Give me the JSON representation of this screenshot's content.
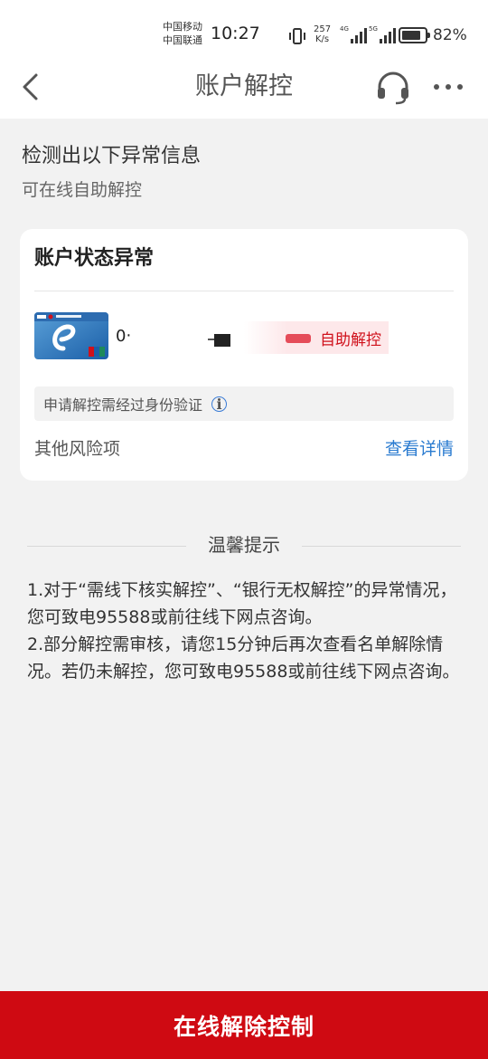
{
  "status_bar": {
    "carrier_1": "中国移动",
    "carrier_2": "中国联通",
    "time": "10:27",
    "net_speed_value": "257",
    "net_speed_unit": "K/s",
    "signal_1_label": "4G",
    "signal_2_label": "5G",
    "battery_percent": "82%",
    "battery_level": 0.82
  },
  "nav": {
    "title": "账户解控",
    "back_icon": "chevron-left-icon",
    "support_icon": "headset-icon",
    "more_icon": "more-dots-icon"
  },
  "header": {
    "headline": "检测出以下异常信息",
    "subline": "可在线自助解控"
  },
  "card": {
    "title": "账户状态异常",
    "account_number_visible": "0‧",
    "self_unlock_label": "自助解控",
    "verify_tip": "申请解控需经过身份验证",
    "other_risk_label": "其他风险项",
    "view_details_label": "查看详情"
  },
  "tips": {
    "title": "温馨提示",
    "item_1": "1.对于“需线下核实解控”、“银行无权解控”的异常情况，您可致电95588或前往线下网点咨询。",
    "item_2": "2.部分解控需审核，请您15分钟后再次查看名单解除情况。若仍未解控，您可致电95588或前往线下网点咨询。"
  },
  "bottom_button": {
    "label": "在线解除控制"
  },
  "colors": {
    "brand_red": "#cf0a12",
    "link_blue": "#2a7bd0"
  }
}
